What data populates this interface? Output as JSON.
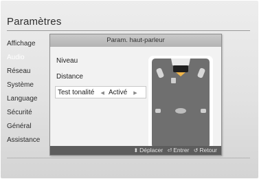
{
  "screen": {
    "title": "Paramètres"
  },
  "left_menu": [
    {
      "label": "Affichage",
      "active": false
    },
    {
      "label": "Audio",
      "active": true
    },
    {
      "label": "Réseau",
      "active": false
    },
    {
      "label": "Système",
      "active": false
    },
    {
      "label": "Language",
      "active": false
    },
    {
      "label": "Sécurité",
      "active": false
    },
    {
      "label": "Général",
      "active": false
    },
    {
      "label": "Assistance",
      "active": false
    }
  ],
  "popup": {
    "title": "Param. haut-parleur",
    "items": [
      {
        "label": "Niveau"
      },
      {
        "label": "Distance"
      },
      {
        "label": "Test tonalité",
        "value": "Activé"
      }
    ],
    "footer": [
      {
        "icon": "updown-arrows-icon",
        "glyph": "⬍",
        "label": "Déplacer"
      },
      {
        "icon": "enter-icon",
        "glyph": "⏎",
        "label": "Entrer"
      },
      {
        "icon": "return-icon",
        "glyph": "↺",
        "label": "Retour"
      }
    ]
  },
  "colors": {
    "popup_footer_bg": "#5d5d5d",
    "selected_item_bg": "#ffffff",
    "speaker_layout_bg": "#6f6f6f",
    "speaker_highlight": "#f0b54a"
  }
}
